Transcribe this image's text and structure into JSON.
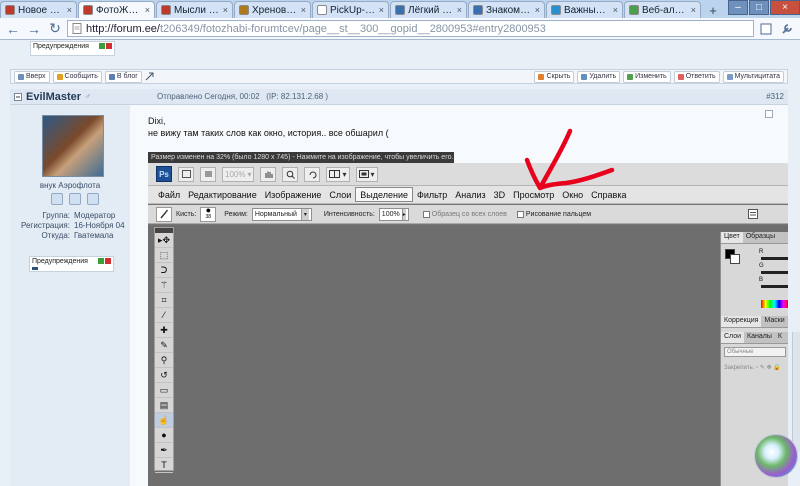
{
  "browser": {
    "tabs": [
      {
        "label": "Новое на ф...",
        "favicon_color": "#c0392b",
        "active": false
      },
      {
        "label": "ФотоЖабы ...",
        "favicon_color": "#c0392b",
        "active": true
      },
      {
        "label": "Мысли всл...",
        "favicon_color": "#c0392b",
        "active": false
      },
      {
        "label": "Хреновина...",
        "favicon_color": "#b07a1c",
        "active": false
      },
      {
        "label": "PickUp-Gu.r...",
        "favicon_color": "#ffffff",
        "active": false
      },
      {
        "label": "Лёгкий спо...",
        "favicon_color": "#3a6fb0",
        "active": false
      },
      {
        "label": "Знакомства...",
        "favicon_color": "#3a6fb0",
        "active": false
      },
      {
        "label": "Важные ме...",
        "favicon_color": "#2a8fd0",
        "active": false
      },
      {
        "label": "Веб-альбо...",
        "favicon_color": "#4aa04a",
        "active": false
      }
    ],
    "tab_close": "×",
    "new_tab": "+",
    "window_controls": {
      "minimize": "–",
      "maximize": "□",
      "close": "×"
    },
    "nav": {
      "back": "←",
      "forward": "→",
      "reload": "↻",
      "page_menu": "▾",
      "tools_menu": "▾"
    },
    "url": {
      "host": "http://forum.ee/",
      "path": "t206349/fotozhabi-forumtcev/page__st__300__gopid__2800953#entry2800953"
    }
  },
  "forum": {
    "top_warning_label": "Предупреждения",
    "actions_left": [
      {
        "label": "Вверх",
        "icon": "arrow-up-icon"
      },
      {
        "label": "Сообщить",
        "icon": "warning-icon"
      },
      {
        "label": "В блог",
        "icon": "blog-icon"
      }
    ],
    "actions_right": [
      {
        "label": "Скрыть",
        "icon": "hide-icon"
      },
      {
        "label": "Удалить",
        "icon": "delete-icon"
      },
      {
        "label": "Изменить",
        "icon": "edit-icon"
      },
      {
        "label": "Ответить",
        "icon": "reply-icon"
      },
      {
        "label": "Мультицитата",
        "icon": "multiquote-icon"
      }
    ],
    "post": {
      "author": "EvilMaster",
      "author_marker": "♂",
      "sent": "Отправлено Сегодня, 00:02",
      "ip": "(IP: 82.131.2.68 )",
      "number": "#312",
      "rank": "внук Аэрофлота",
      "group_label": "Группа:",
      "group_value": "Модератор",
      "reg_label": "Регистрация:",
      "reg_value": "16-Ноября 04",
      "from_label": "Откуда:",
      "from_value": "Гватемала",
      "warnings_label": "Предупреждения",
      "text_line1": "Dixi,",
      "text_line2": "не вижу там таких слов как окно, история.. все обшарил ("
    },
    "resize_notice": "Размер изменен на 32% (было 1280 x 745) - Нажмите на изображение, чтобы увеличить его."
  },
  "photoshop": {
    "logo": "Ps",
    "zoom": "100%",
    "menu": [
      "Файл",
      "Редактирование",
      "Изображение",
      "Слои",
      "Выделение",
      "Фильтр",
      "Анализ",
      "3D",
      "Просмотр",
      "Окно",
      "Справка"
    ],
    "selected_menu": "Выделение",
    "options": {
      "brush_label": "Кисть:",
      "brush_size": "38",
      "mode_label": "Режим:",
      "mode_value": "Нормальный",
      "intensity_label": "Интенсивность:",
      "intensity_value": "100%",
      "sample_all": "Образец со всех слоев",
      "finger_painting": "Рисование пальцем"
    },
    "panels": {
      "color_tabs": [
        "Цвет",
        "Образцы"
      ],
      "channels": [
        "R",
        "G",
        "B"
      ],
      "adjust_tabs": [
        "Коррекция",
        "Маски"
      ],
      "layer_tabs": [
        "Слои",
        "Каналы",
        "К"
      ],
      "blend_mode": "Обычные",
      "lock_label": "Закрепить:"
    },
    "tools": [
      "move-icon",
      "marquee-icon",
      "lasso-icon",
      "magic-wand-icon",
      "crop-icon",
      "eyedropper-icon",
      "healing-icon",
      "brush-icon",
      "clone-stamp-icon",
      "history-brush-icon",
      "eraser-icon",
      "gradient-icon",
      "smudge-icon",
      "dodge-icon",
      "pen-icon",
      "type-icon"
    ]
  },
  "colors": {
    "annotation_arrow": "#e8001c",
    "forum_bg": "#e9eff6",
    "ps_canvas": "#6e6e6e"
  }
}
